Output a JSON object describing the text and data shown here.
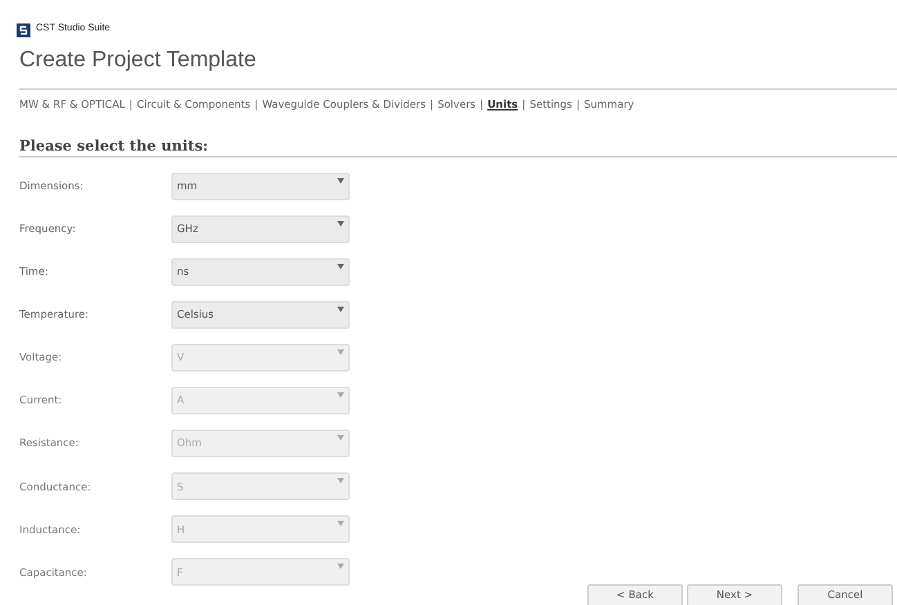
{
  "window": {
    "title": "CST Studio Suite"
  },
  "page_title": "Create Project Template",
  "steps": [
    {
      "label": "MW & RF & OPTICAL",
      "selected": false
    },
    {
      "label": "Circuit & Components",
      "selected": false
    },
    {
      "label": "Waveguide Couplers & Dividers",
      "selected": false
    },
    {
      "label": "Solvers",
      "selected": false
    },
    {
      "label": "Units",
      "selected": true
    },
    {
      "label": "Settings",
      "selected": false
    },
    {
      "label": "Summary",
      "selected": false
    }
  ],
  "step_separator": "|",
  "section_title": "Please select the units:",
  "units": [
    {
      "label": "Dimensions:",
      "value": "mm",
      "disabled": false
    },
    {
      "label": "Frequency:",
      "value": "GHz",
      "disabled": false
    },
    {
      "label": "Time:",
      "value": "ns",
      "disabled": false
    },
    {
      "label": "Temperature:",
      "value": "Celsius",
      "disabled": false
    },
    {
      "label": "Voltage:",
      "value": "V",
      "disabled": true
    },
    {
      "label": "Current:",
      "value": "A",
      "disabled": true
    },
    {
      "label": "Resistance:",
      "value": "Ohm",
      "disabled": true
    },
    {
      "label": "Conductance:",
      "value": "S",
      "disabled": true
    },
    {
      "label": "Inductance:",
      "value": "H",
      "disabled": true
    },
    {
      "label": "Capacitance:",
      "value": "F",
      "disabled": true
    }
  ],
  "buttons": [
    "< Back",
    "Next >",
    "Cancel"
  ]
}
